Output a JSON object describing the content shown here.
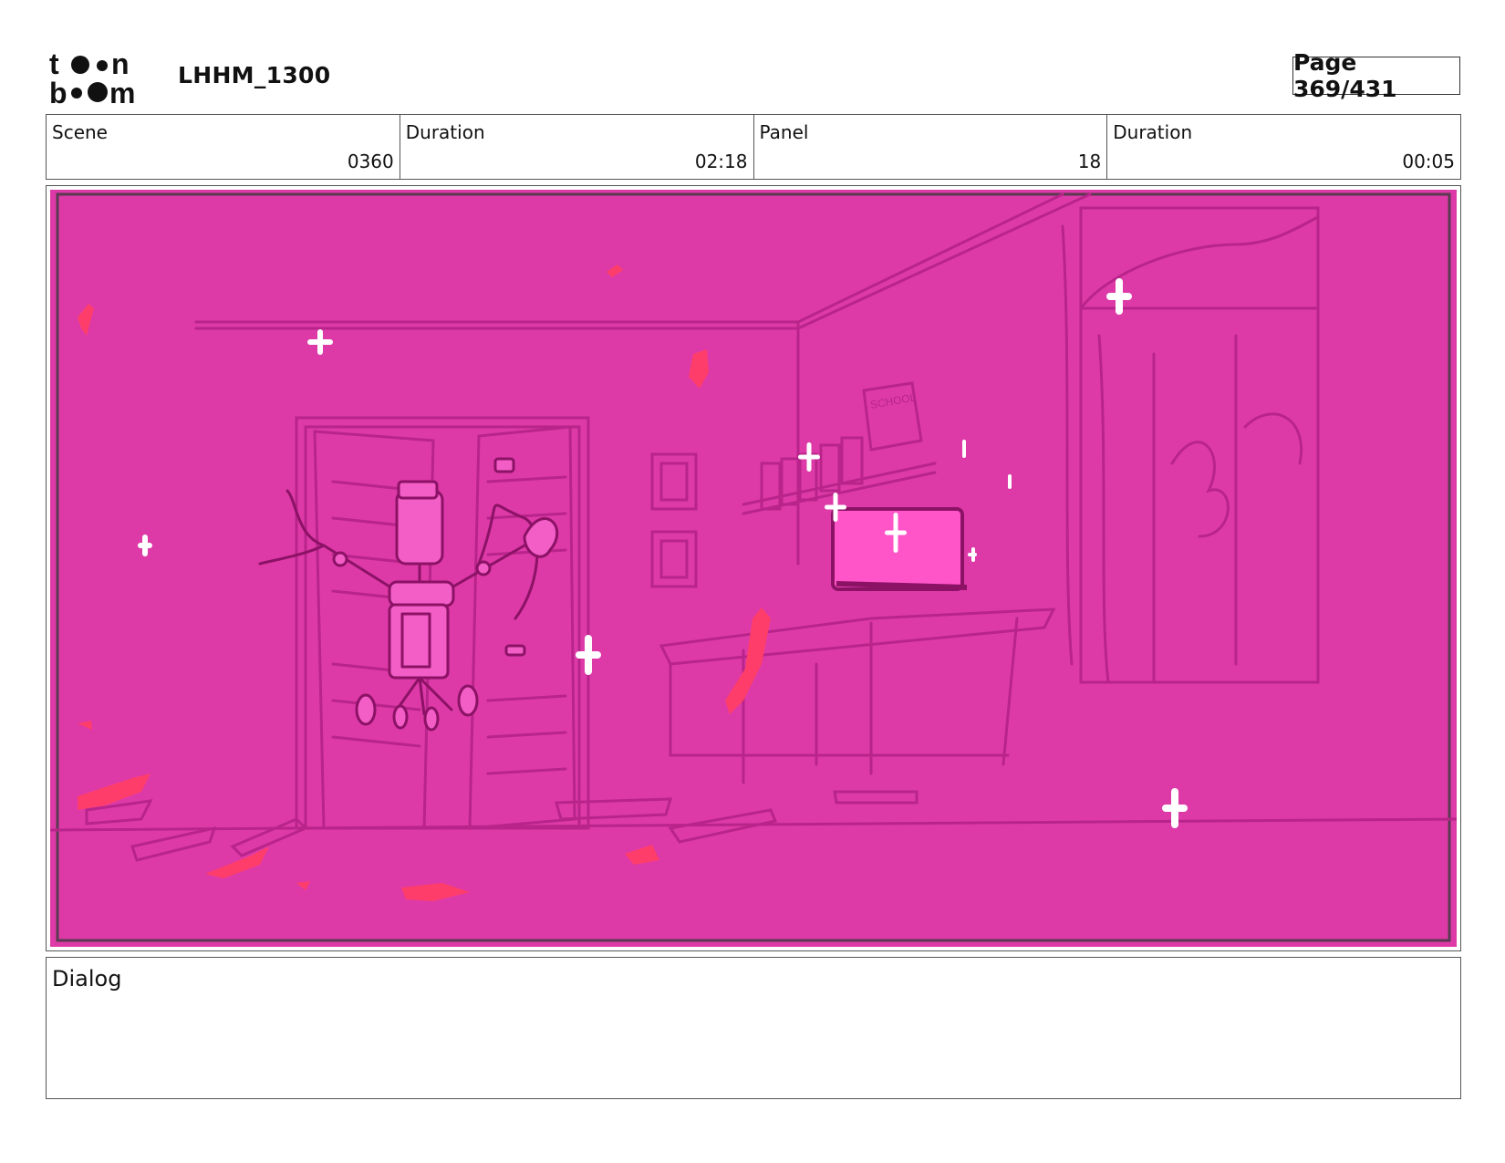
{
  "brand": {
    "logo_text": "toon boom",
    "logo_icon": "toon-boom-logo"
  },
  "header": {
    "project_title": "LHHM_1300",
    "page_label": "Page 369/431"
  },
  "info": {
    "scene_label": "Scene",
    "scene_value": "0360",
    "scene_duration_label": "Duration",
    "scene_duration_value": "02:18",
    "panel_label": "Panel",
    "panel_value": "18",
    "panel_duration_label": "Duration",
    "panel_duration_value": "00:05"
  },
  "panel_image": {
    "sign_text": "SCHOOL",
    "colors": {
      "background": "#dd3aa8",
      "line": "#b8248a",
      "robot": "#f25ec6",
      "screen": "#ff55c8",
      "debris": "#ff3d6a",
      "sparkle": "#ffffff"
    }
  },
  "dialog": {
    "label": "Dialog",
    "text": ""
  }
}
